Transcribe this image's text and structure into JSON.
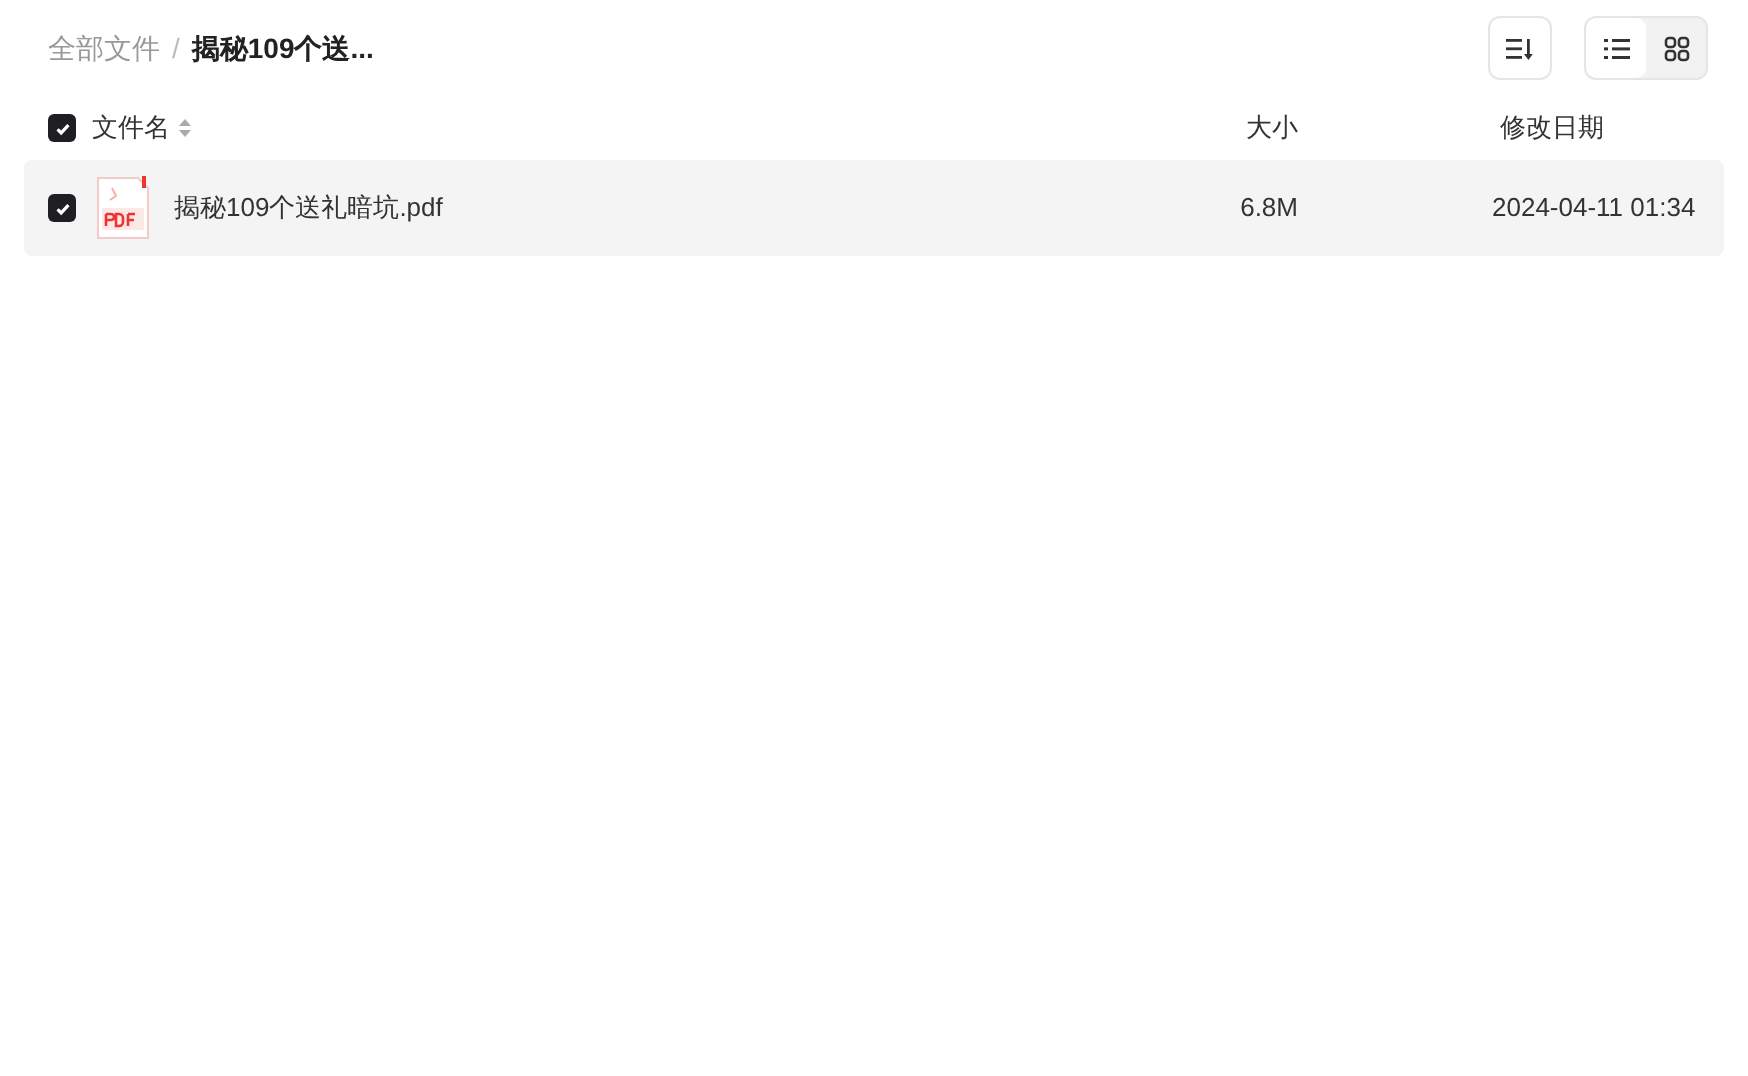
{
  "breadcrumb_separator": "/",
  "breadcrumb": [
    {
      "label": "全部文件",
      "current": false
    },
    {
      "label": "揭秘109个送...",
      "current": true
    }
  ],
  "view_modes": [
    {
      "kind": "list",
      "selected": true
    },
    {
      "kind": "grid",
      "selected": false
    }
  ],
  "header": {
    "checked": true,
    "name": "文件名",
    "size": "大小",
    "modified": "修改日期"
  },
  "files": [
    {
      "kind": "pdf",
      "checked": true,
      "name": "揭秘109个送礼暗坑.pdf",
      "size": "6.8M",
      "modified": "2024-04-11 01:34"
    }
  ]
}
